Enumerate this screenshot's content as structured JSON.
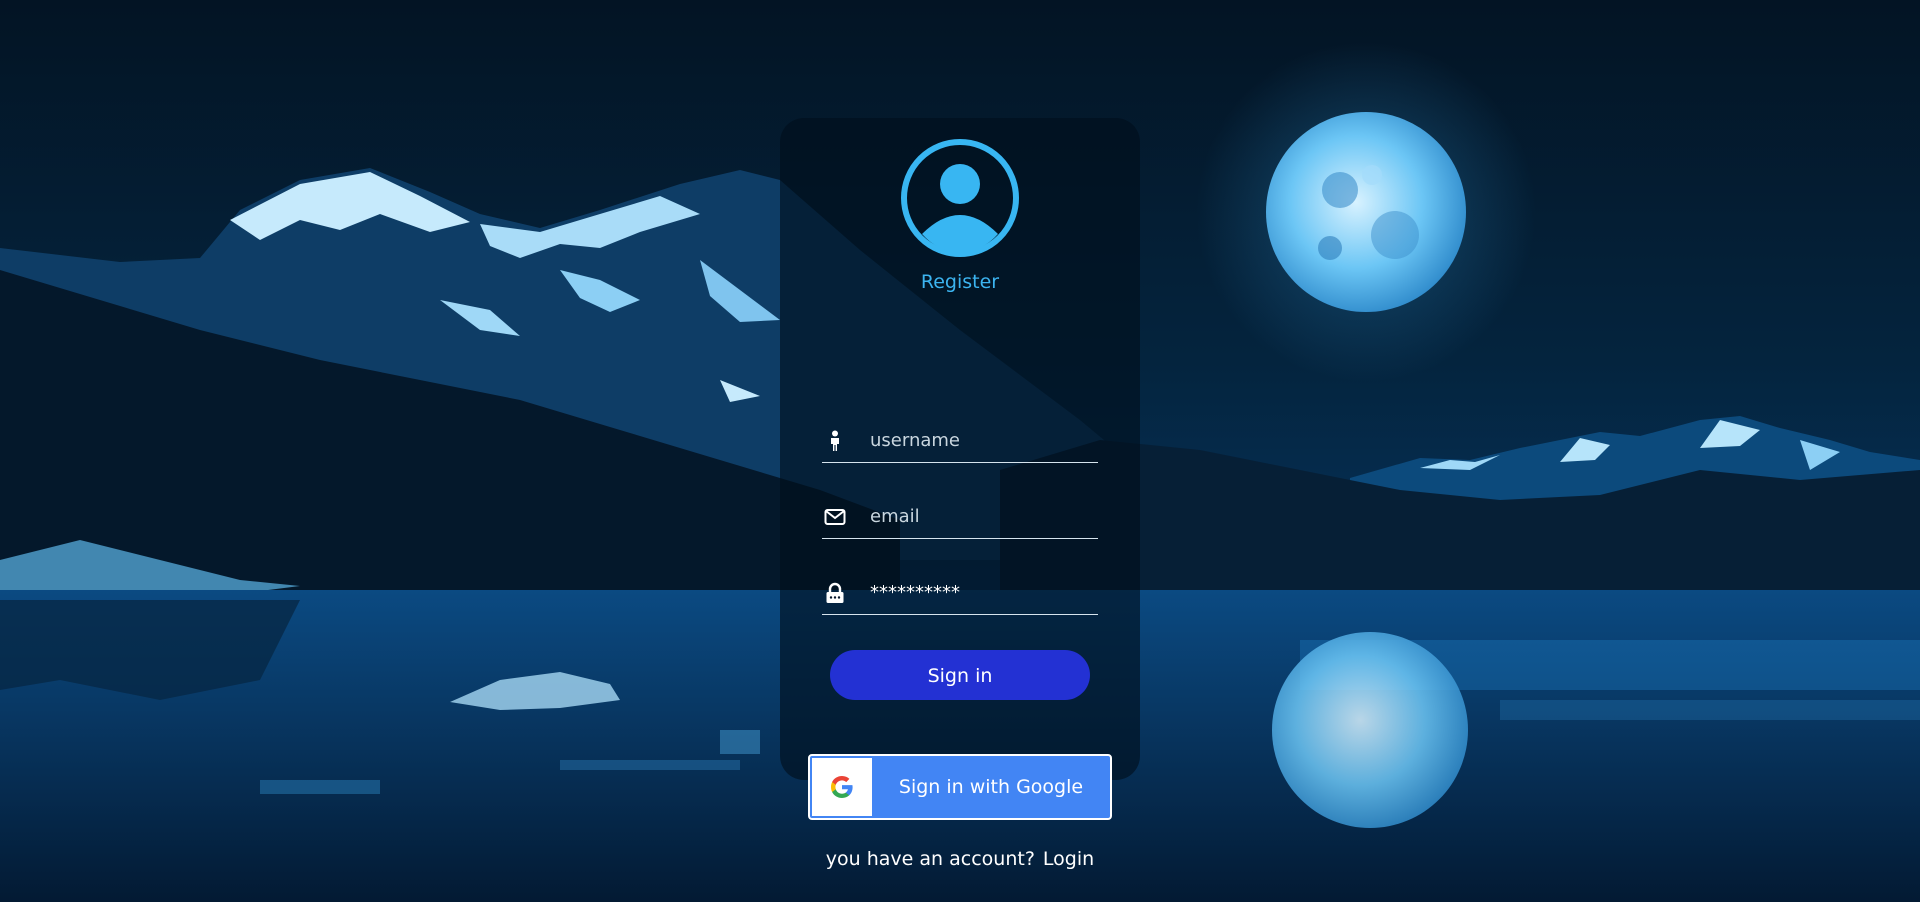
{
  "form": {
    "title": "Register",
    "username_placeholder": "username",
    "email_placeholder": "email",
    "password_value": "**********",
    "signin_label": "Sign in",
    "google_label": "Sign in with Google",
    "footer_text": "you have an account?",
    "login_link": "Login"
  },
  "icons": {
    "avatar": "user-circle-icon",
    "username": "person-icon",
    "email": "envelope-icon",
    "password": "lock-icon",
    "google": "google-g-icon"
  },
  "colors": {
    "accent": "#3cb4f0",
    "signin_button": "#2331d3",
    "google_button": "#4285f4",
    "card_background": "rgba(0,14,28,0.62)"
  }
}
